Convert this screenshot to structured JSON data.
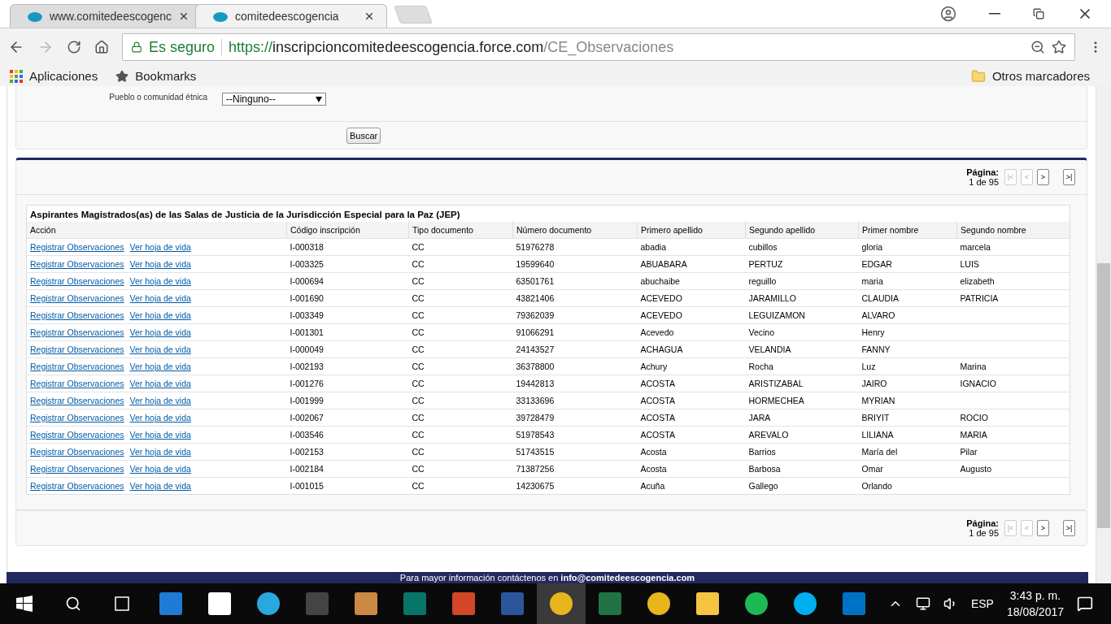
{
  "browser": {
    "tabs": [
      {
        "title": "www.comitedeescogenc",
        "selected": false
      },
      {
        "title": "comitedeescogencia",
        "selected": true
      }
    ],
    "security": "Es seguro",
    "url": {
      "scheme": "https://",
      "host": "inscripcioncomitedeescogencia.force.com",
      "path": "/CE_Observaciones"
    },
    "bookmarks": [
      "Aplicaciones",
      "Bookmarks"
    ],
    "other_bookmarks": "Otros marcadores"
  },
  "filter": {
    "label": "Pueblo o comunidad étnica",
    "value": "--Ninguno--",
    "button": "Buscar"
  },
  "pager_top": {
    "label": "Página:",
    "count": "1 de 95",
    "buttons": [
      {
        "text": "|<",
        "disabled": true
      },
      {
        "text": "<",
        "disabled": true
      },
      {
        "text": ">",
        "disabled": false
      },
      {
        "text": ">|",
        "disabled": false
      }
    ]
  },
  "table": {
    "title": "Aspirantes Magistrados(as) de las Salas de Justicia de la Jurisdicción Especial para la Paz (JEP)",
    "columns": [
      "Acción",
      "Código inscripción",
      "Tipo documento",
      "Número documento",
      "Primero apellido",
      "Segundo apellido",
      "Primer nombre",
      "Segundo nombre"
    ],
    "rows": [
      {
        "cells": [
          [
            "Registrar Observaciones",
            "Ver hoja de vida"
          ],
          "I-000318",
          "CC",
          "51976278",
          "abadia",
          "cubillos",
          "gloria",
          "marcela"
        ]
      },
      {
        "cells": [
          [
            "Registrar Observaciones",
            "Ver hoja de vida"
          ],
          "I-003325",
          "CC",
          "19599640",
          "ABUABARA",
          "PERTUZ",
          "EDGAR",
          "LUIS"
        ]
      },
      {
        "cells": [
          [
            "Registrar Observaciones",
            "Ver hoja de vida"
          ],
          "I-000694",
          "CC",
          "63501761",
          "abuchaibe",
          "reguillo",
          "maria",
          "elizabeth"
        ]
      },
      {
        "cells": [
          [
            "Registrar Observaciones",
            "Ver hoja de vida"
          ],
          "I-001690",
          "CC",
          "43821406",
          "ACEVEDO",
          "JARAMILLO",
          "CLAUDIA",
          "PATRICIA"
        ]
      },
      {
        "cells": [
          [
            "Registrar Observaciones",
            "Ver hoja de vida"
          ],
          "I-003349",
          "CC",
          "79362039",
          "ACEVEDO",
          "LEGUIZAMON",
          "ALVARO",
          ""
        ]
      },
      {
        "cells": [
          [
            "Registrar Observaciones",
            "Ver hoja de vida"
          ],
          "I-001301",
          "CC",
          "91066291",
          "Acevedo",
          "Vecino",
          "Henry",
          ""
        ]
      },
      {
        "cells": [
          [
            "Registrar Observaciones",
            "Ver hoja de vida"
          ],
          "I-000049",
          "CC",
          "24143527",
          "ACHAGUA",
          "VELANDIA",
          "FANNY",
          ""
        ]
      },
      {
        "cells": [
          [
            "Registrar Observaciones",
            "Ver hoja de vida"
          ],
          "I-002193",
          "CC",
          "36378800",
          "Achury",
          "Rocha",
          "Luz",
          "Marina"
        ]
      },
      {
        "cells": [
          [
            "Registrar Observaciones",
            "Ver hoja de vida"
          ],
          "I-001276",
          "CC",
          "19442813",
          "ACOSTA",
          "ARISTIZABAL",
          "JAIRO",
          "IGNACIO"
        ]
      },
      {
        "cells": [
          [
            "Registrar Observaciones",
            "Ver hoja de vida"
          ],
          "I-001999",
          "CC",
          "33133696",
          "ACOSTA",
          "HORMECHEA",
          "MYRIAN",
          ""
        ]
      },
      {
        "cells": [
          [
            "Registrar Observaciones",
            "Ver hoja de vida"
          ],
          "I-002067",
          "CC",
          "39728479",
          "ACOSTA",
          "JARA",
          "BRIYIT",
          "ROCIO"
        ]
      },
      {
        "cells": [
          [
            "Registrar Observaciones",
            "Ver hoja de vida"
          ],
          "I-003546",
          "CC",
          "51978543",
          "ACOSTA",
          "AREVALO",
          "LILIANA",
          "MARIA"
        ]
      },
      {
        "cells": [
          [
            "Registrar Observaciones",
            "Ver hoja de vida"
          ],
          "I-002153",
          "CC",
          "51743515",
          "Acosta",
          "Barrios",
          "María del",
          "Pilar"
        ]
      },
      {
        "cells": [
          [
            "Registrar Observaciones",
            "Ver hoja de vida"
          ],
          "I-002184",
          "CC",
          "71387256",
          "Acosta",
          "Barbosa",
          "Omar",
          "Augusto"
        ]
      },
      {
        "cells": [
          [
            "Registrar Observaciones",
            "Ver hoja de vida"
          ],
          "I-001015",
          "CC",
          "14230675",
          "Acuña",
          "Gallego",
          "Orlando",
          ""
        ]
      }
    ]
  },
  "pager_bottom": {
    "label": "Página:",
    "count": "1 de 95",
    "buttons": [
      {
        "text": "|<",
        "disabled": true
      },
      {
        "text": "<",
        "disabled": true
      },
      {
        "text": ">",
        "disabled": false
      },
      {
        "text": ">|",
        "disabled": false
      }
    ]
  },
  "footer": "Para mayor información contáctenos  en **info@comitedeescogencia.com**",
  "taskbar": {
    "apps": [
      {
        "kind": "edge",
        "active": false
      },
      {
        "kind": "store",
        "active": false
      },
      {
        "kind": "ie",
        "active": false
      },
      {
        "kind": "camera",
        "active": false
      },
      {
        "kind": "puzzle",
        "active": false
      },
      {
        "kind": "publisher",
        "active": false
      },
      {
        "kind": "powerpoint",
        "active": false
      },
      {
        "kind": "word",
        "active": false
      },
      {
        "kind": "chrome",
        "active": true
      },
      {
        "kind": "excel",
        "active": false
      },
      {
        "kind": "chrome",
        "active": false
      },
      {
        "kind": "explorer",
        "active": false
      },
      {
        "kind": "spotify",
        "active": false
      },
      {
        "kind": "skype",
        "active": false
      },
      {
        "kind": "outlook",
        "active": false
      }
    ],
    "language": "ESP",
    "time": "3:43 p. m.",
    "date": "18/08/2017"
  }
}
